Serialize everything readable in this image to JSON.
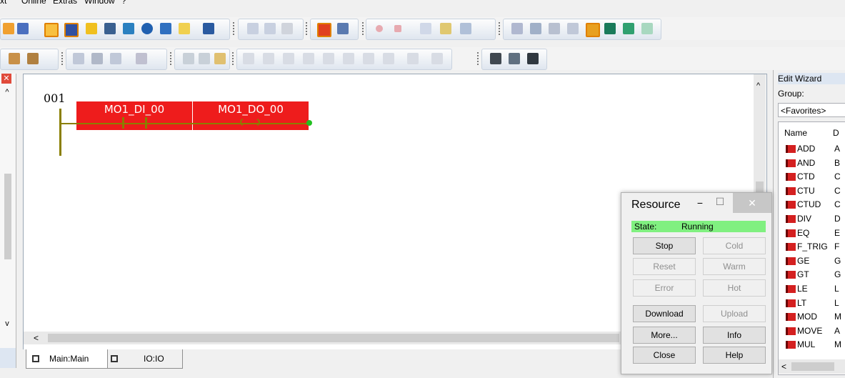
{
  "menu": {
    "items": [
      "xt",
      "Online",
      "Extras",
      "Window",
      "?"
    ]
  },
  "editor": {
    "rung_number": "001",
    "contact_label": "MO1_DI_00",
    "coil_label": "MO1_DO_00",
    "scroll_left_arrow": "<"
  },
  "tabs": {
    "main_label": "Main:Main",
    "io_label": "IO:IO"
  },
  "resource": {
    "title": "Resource",
    "minimize": "−",
    "maximize": "☐",
    "close": "✕",
    "state_label": "State:",
    "state_value": "Running",
    "buttons": {
      "stop": "Stop",
      "cold": "Cold",
      "reset": "Reset",
      "warm": "Warm",
      "error": "Error",
      "hot": "Hot",
      "download": "Download",
      "upload": "Upload",
      "more": "More...",
      "info": "Info",
      "close": "Close",
      "help": "Help"
    }
  },
  "wizard": {
    "title": "Edit Wizard",
    "group_label": "Group:",
    "group_value": "<Favorites>",
    "col_name": "Name",
    "col_desc": "D",
    "items": [
      {
        "name": "ADD",
        "desc": "A"
      },
      {
        "name": "AND",
        "desc": "B"
      },
      {
        "name": "CTD",
        "desc": "C"
      },
      {
        "name": "CTU",
        "desc": "C"
      },
      {
        "name": "CTUD",
        "desc": "C"
      },
      {
        "name": "DIV",
        "desc": "D"
      },
      {
        "name": "EQ",
        "desc": "E"
      },
      {
        "name": "F_TRIG",
        "desc": "F"
      },
      {
        "name": "GE",
        "desc": "G"
      },
      {
        "name": "GT",
        "desc": "G"
      },
      {
        "name": "LE",
        "desc": "L"
      },
      {
        "name": "LT",
        "desc": "L"
      },
      {
        "name": "MOD",
        "desc": "M"
      },
      {
        "name": "MOVE",
        "desc": "A"
      },
      {
        "name": "MUL",
        "desc": "M"
      }
    ],
    "scroll_left_arrow": "<"
  },
  "colors": {
    "rung_block": "#ee1c1c",
    "state_bg": "#80f080",
    "power_rail": "#8a7f00"
  }
}
